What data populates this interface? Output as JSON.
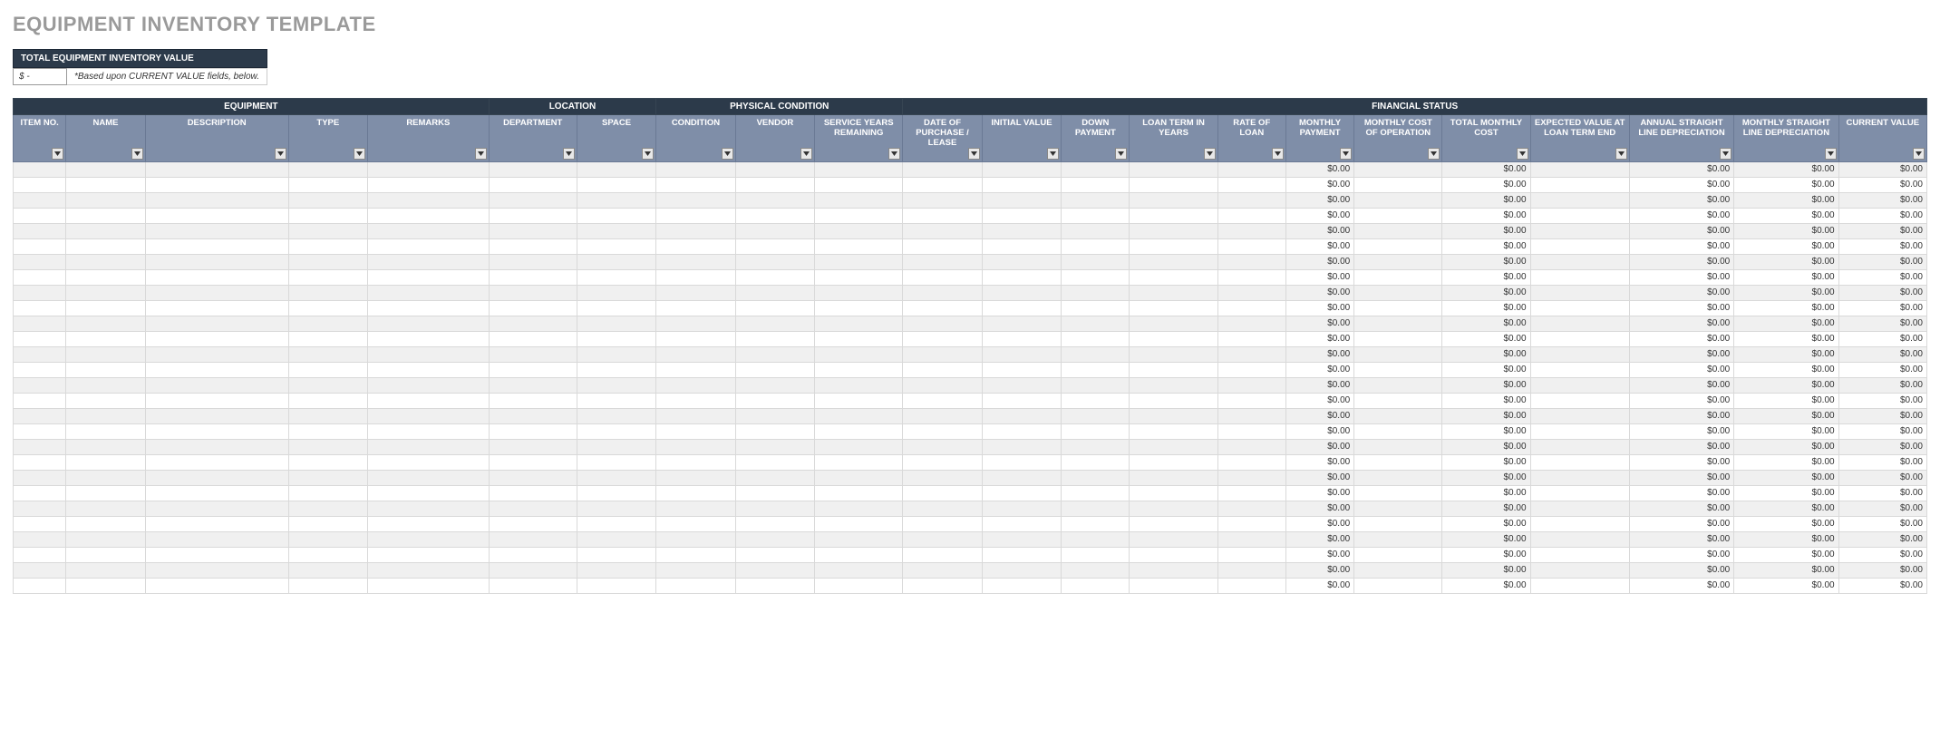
{
  "title": "EQUIPMENT INVENTORY TEMPLATE",
  "summary": {
    "header": "TOTAL EQUIPMENT INVENTORY VALUE",
    "value": "$         -",
    "note": "*Based upon CURRENT VALUE fields, below."
  },
  "groups": [
    {
      "label": "EQUIPMENT",
      "span": 5
    },
    {
      "label": "LOCATION",
      "span": 2
    },
    {
      "label": "PHYSICAL CONDITION",
      "span": 3
    },
    {
      "label": "FINANCIAL STATUS",
      "span": 12
    }
  ],
  "columns": [
    {
      "key": "item_no",
      "label": "ITEM NO."
    },
    {
      "key": "name",
      "label": "NAME"
    },
    {
      "key": "description",
      "label": "DESCRIPTION"
    },
    {
      "key": "type",
      "label": "TYPE"
    },
    {
      "key": "remarks",
      "label": "REMARKS"
    },
    {
      "key": "department",
      "label": "DEPARTMENT"
    },
    {
      "key": "space",
      "label": "SPACE"
    },
    {
      "key": "condition",
      "label": "CONDITION"
    },
    {
      "key": "vendor",
      "label": "VENDOR"
    },
    {
      "key": "service_years_remaining",
      "label": "SERVICE YEARS REMAINING"
    },
    {
      "key": "date_of_purchase_lease",
      "label": "DATE OF PURCHASE / LEASE"
    },
    {
      "key": "initial_value",
      "label": "INITIAL VALUE"
    },
    {
      "key": "down_payment",
      "label": "DOWN PAYMENT"
    },
    {
      "key": "loan_term_years",
      "label": "LOAN TERM IN YEARS"
    },
    {
      "key": "rate_of_loan",
      "label": "RATE OF LOAN"
    },
    {
      "key": "monthly_payment",
      "label": "MONTHLY PAYMENT"
    },
    {
      "key": "monthly_cost_of_operation",
      "label": "MONTHLY COST OF OPERATION"
    },
    {
      "key": "total_monthly_cost",
      "label": "TOTAL MONTHLY COST"
    },
    {
      "key": "expected_value_loan_term_end",
      "label": "EXPECTED VALUE AT LOAN TERM END"
    },
    {
      "key": "annual_sl_depreciation",
      "label": "ANNUAL STRAIGHT LINE DEPRECIATION"
    },
    {
      "key": "monthly_sl_depreciation",
      "label": "MONTHLY STRAIGHT LINE DEPRECIATION"
    },
    {
      "key": "current_value",
      "label": "CURRENT VALUE"
    }
  ],
  "calc_columns": [
    "monthly_payment",
    "total_monthly_cost",
    "annual_sl_depreciation",
    "monthly_sl_depreciation",
    "current_value"
  ],
  "calc_value": "$0.00",
  "row_count": 28
}
